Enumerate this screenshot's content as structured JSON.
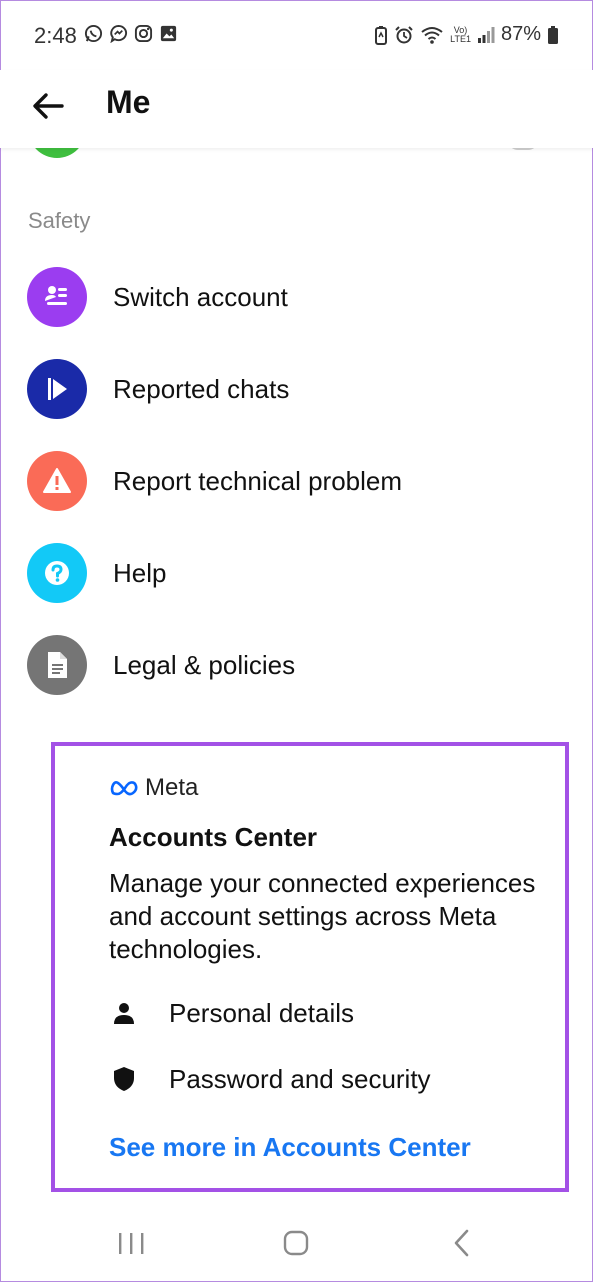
{
  "status_bar": {
    "time": "2:48",
    "app_icons": [
      "whatsapp-icon",
      "messenger-icon",
      "instagram-icon",
      "gallery-icon"
    ],
    "network_label_top": "Vo)",
    "network_label_bottom": "LTE1",
    "battery": "87%"
  },
  "header": {
    "title": "Me"
  },
  "section": {
    "label": "Safety"
  },
  "menu": {
    "items": [
      {
        "label": "Switch account",
        "icon": "switch-account-icon",
        "color": "#9b3df0"
      },
      {
        "label": "Reported chats",
        "icon": "flag-icon",
        "color": "#1a2aa8"
      },
      {
        "label": "Report technical problem",
        "icon": "warning-icon",
        "color": "#fa6b57"
      },
      {
        "label": "Help",
        "icon": "help-icon",
        "color": "#12c9f7"
      },
      {
        "label": "Legal & policies",
        "icon": "document-icon",
        "color": "#757575"
      }
    ]
  },
  "accounts_center": {
    "brand": "Meta",
    "title": "Accounts Center",
    "description": "Manage your connected experiences and account settings across Meta technologies.",
    "rows": [
      {
        "label": "Personal details",
        "icon": "person-icon"
      },
      {
        "label": "Password and security",
        "icon": "shield-icon"
      }
    ],
    "link": "See more in Accounts Center",
    "highlight_color": "#a351e6",
    "link_color": "#1877f2"
  },
  "nav": {
    "buttons": [
      "recents-button",
      "home-button",
      "back-button"
    ]
  }
}
